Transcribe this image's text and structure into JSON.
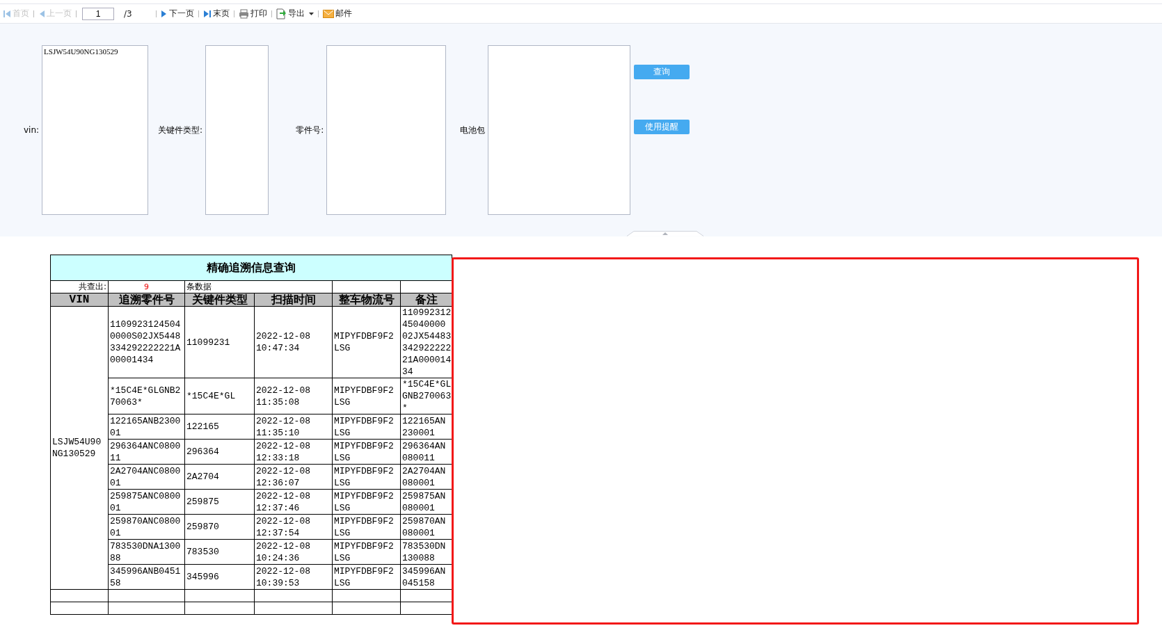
{
  "toolbar": {
    "items": [
      {
        "kind": "first",
        "label": "首页",
        "disabled": true
      },
      {
        "kind": "prev",
        "label": "上一页",
        "disabled": true
      },
      {
        "kind": "page",
        "value": "1",
        "total": "/3"
      },
      {
        "kind": "next",
        "label": "下一页",
        "disabled": false
      },
      {
        "kind": "last",
        "label": "末页",
        "disabled": false
      },
      {
        "kind": "print",
        "label": "打印",
        "disabled": false
      },
      {
        "kind": "export",
        "label": "导出",
        "disabled": false
      },
      {
        "kind": "mail",
        "label": "邮件",
        "disabled": false
      }
    ]
  },
  "form": {
    "fields": [
      {
        "label": "vin:",
        "value": "LSJW54U90NG130529"
      },
      {
        "label": "关键件类型:"
      },
      {
        "label": "零件号:"
      },
      {
        "label": "电池包"
      }
    ],
    "buttons": [
      "查询",
      "使用提醒"
    ]
  },
  "report": {
    "title": "精确追溯信息查询",
    "count_label": "共查出:",
    "count": "9",
    "count_suffix": "条数据",
    "columns": [
      "VIN",
      "追溯零件号",
      "关键件类型",
      "扫描时间",
      "整车物流号",
      "备注"
    ],
    "groups": [
      {
        "vin": "LSJW54U90NG130529",
        "rows": [
          {
            "part_no": "11099231245040000S02JX5448334292222221A00001434",
            "key_type": "11099231",
            "scan_time": "2022-12-08 10:47:34",
            "logistics_no": "MIPYFDBF9F2LSG",
            "remark": "110992312\n45040000\n02JX54483\n342922222\n21A000014\n34"
          },
          {
            "part_no": "*15C4E*GLGNB270063*",
            "key_type": "*15C4E*GL",
            "scan_time": "2022-12-08 11:35:08",
            "logistics_no": "MIPYFDBF9F2LSG",
            "remark": "*15C4E*GL\nGNB270063\n*"
          },
          {
            "part_no": "122165ANB230001",
            "key_type": "122165",
            "scan_time": "2022-12-08 11:35:10",
            "logistics_no": "MIPYFDBF9F2LSG",
            "remark": "122165AN\n230001"
          },
          {
            "part_no": "296364ANC080011",
            "key_type": "296364",
            "scan_time": "2022-12-08 12:33:18",
            "logistics_no": "MIPYFDBF9F2LSG",
            "remark": "296364AN\n080011"
          },
          {
            "part_no": "2A2704ANC080001",
            "key_type": "2A2704",
            "scan_time": "2022-12-08 12:36:07",
            "logistics_no": "MIPYFDBF9F2LSG",
            "remark": "2A2704AN\n080001"
          },
          {
            "part_no": "259875ANC080001",
            "key_type": "259875",
            "scan_time": "2022-12-08 12:37:46",
            "logistics_no": "MIPYFDBF9F2LSG",
            "remark": "259875AN\n080001"
          },
          {
            "part_no": "259870ANC080001",
            "key_type": "259870",
            "scan_time": "2022-12-08 12:37:54",
            "logistics_no": "MIPYFDBF9F2LSG",
            "remark": "259870AN\n080001"
          },
          {
            "part_no": "783530DNA130088",
            "key_type": "783530",
            "scan_time": "2022-12-08 10:24:36",
            "logistics_no": "MIPYFDBF9F2LSG",
            "remark": "783530DN\n130088"
          },
          {
            "part_no": "345996ANB045158",
            "key_type": "345996",
            "scan_time": "2022-12-08 10:39:53",
            "logistics_no": "MIPYFDBF9F2LSG",
            "remark": "345996AN\n045158"
          }
        ]
      }
    ]
  }
}
